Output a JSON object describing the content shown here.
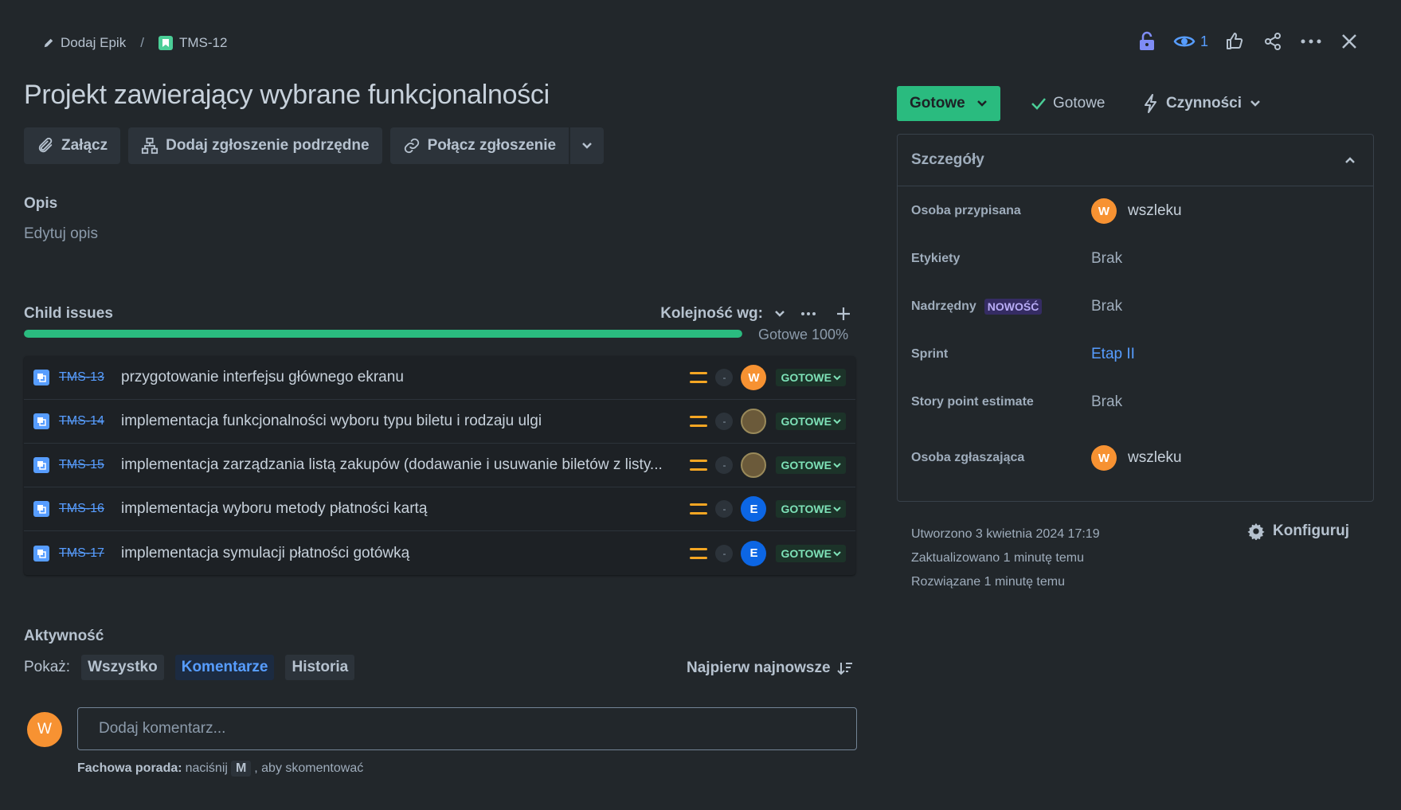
{
  "breadcrumb": {
    "epic_label": "Dodaj Epik",
    "separator": "/",
    "issue_key": "TMS-12"
  },
  "header": {
    "watch_count": "1",
    "icons": [
      "unlock-icon",
      "eye-icon",
      "thumbs-up-icon",
      "share-icon",
      "more-icon",
      "close-icon"
    ]
  },
  "issue": {
    "title": "Projekt zawierający wybrane funkcjonalności"
  },
  "toolbar": {
    "attach_label": "Załącz",
    "add_child_label": "Dodaj zgłoszenie podrzędne",
    "link_label": "Połącz zgłoszenie"
  },
  "description": {
    "label": "Opis",
    "edit_placeholder": "Edytuj opis"
  },
  "child_issues": {
    "label": "Child issues",
    "sort_label": "Kolejność wg:",
    "progress_fraction": 1.0,
    "progress_text": "Gotowe 100%",
    "items": [
      {
        "key": "TMS-13",
        "summary": "przygotowanie interfejsu głównego ekranu",
        "estimate": "-",
        "assignee": "W",
        "assignee_type": "letter-orange",
        "status": "GOTOWE"
      },
      {
        "key": "TMS-14",
        "summary": "implementacja funkcjonalności wyboru typu biletu i rodzaju ulgi",
        "estimate": "-",
        "assignee": "",
        "assignee_type": "photo",
        "status": "GOTOWE"
      },
      {
        "key": "TMS-15",
        "summary": "implementacja zarządzania listą zakupów (dodawanie i usuwanie biletów z listy...",
        "estimate": "-",
        "assignee": "",
        "assignee_type": "photo",
        "status": "GOTOWE"
      },
      {
        "key": "TMS-16",
        "summary": "implementacja wyboru metody płatności kartą",
        "estimate": "-",
        "assignee": "E",
        "assignee_type": "letter-blue",
        "status": "GOTOWE"
      },
      {
        "key": "TMS-17",
        "summary": "implementacja symulacji płatności gotówką",
        "estimate": "-",
        "assignee": "E",
        "assignee_type": "letter-blue",
        "status": "GOTOWE"
      }
    ]
  },
  "activity": {
    "label": "Aktywność",
    "show_label": "Pokaż:",
    "filters": [
      "Wszystko",
      "Komentarze",
      "Historia"
    ],
    "active_filter": "Komentarze",
    "sort_label": "Najpierw najnowsze",
    "user_initial": "W",
    "comment_placeholder": "Dodaj komentarz...",
    "hint_prefix": "Fachowa porada:",
    "hint_text": "naciśnij",
    "hint_key": "M",
    "hint_suffix": ", aby skomentować"
  },
  "status": {
    "button_label": "Gotowe",
    "resolution_label": "Gotowe",
    "actions_label": "Czynności"
  },
  "details": {
    "title": "Szczegóły",
    "assignee_label": "Osoba przypisana",
    "assignee_initial": "W",
    "assignee_name": "wszleku",
    "labels_label": "Etykiety",
    "labels_value": "Brak",
    "parent_label": "Nadrzędny",
    "parent_badge": "NOWOŚĆ",
    "parent_value": "Brak",
    "sprint_label": "Sprint",
    "sprint_value": "Etap II",
    "story_points_label": "Story point estimate",
    "story_points_value": "Brak",
    "reporter_label": "Osoba zgłaszająca",
    "reporter_initial": "W",
    "reporter_name": "wszleku"
  },
  "meta": {
    "created": "Utworzono 3 kwietnia 2024 17:19",
    "updated": "Zaktualizowano 1 minutę temu",
    "resolved": "Rozwiązane 1 minutę temu",
    "configure_label": "Konfiguruj"
  },
  "colors": {
    "background": "#22272b",
    "accent_green": "#2abb7f",
    "link_blue": "#579dff",
    "avatar_orange": "#f79232",
    "avatar_blue": "#0c66e4"
  }
}
